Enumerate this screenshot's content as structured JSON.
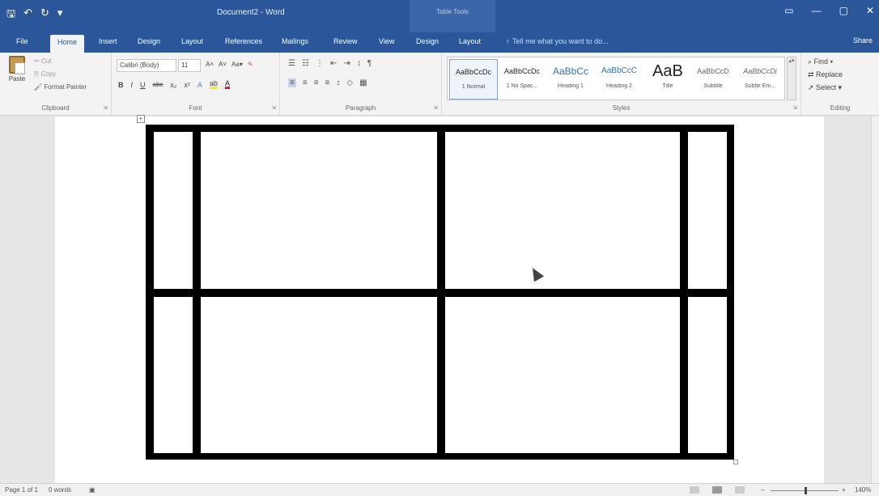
{
  "titlebar": {
    "qat": {
      "save": "🖫",
      "undo": "↶",
      "redo": "↻",
      "customize": "▾"
    },
    "document_title": "Document2 - Word",
    "context_group": "Table Tools",
    "window_buttons": {
      "ribbon_display": "▭",
      "minimize": "—",
      "maximize": "▢",
      "close": "✕"
    }
  },
  "tabs": {
    "file": "File",
    "home": "Home",
    "insert": "Insert",
    "design": "Design",
    "layout": "Layout",
    "references": "References",
    "mailings": "Mailings",
    "review": "Review",
    "view": "View",
    "table_design": "Design",
    "table_layout": "Layout",
    "tell_me": "♀ Tell me what you want to do...",
    "share": "Share"
  },
  "clipboard": {
    "paste": "Paste",
    "cut": "Cut",
    "copy": "Copy",
    "format_painter": "Format Painter",
    "label": "Clipboard"
  },
  "font": {
    "font_name": "Calibri (Body)",
    "font_size": "11",
    "grow": "A˄",
    "shrink": "A˅",
    "change_case": "Aa▾",
    "clear": "✎",
    "bold": "B",
    "italic": "I",
    "underline": "U",
    "strikethrough": "abc",
    "subscript": "x₂",
    "superscript": "x²",
    "text_effects": "A",
    "highlight": "ab",
    "font_color": "A",
    "label": "Font"
  },
  "paragraph": {
    "bullets": "☰",
    "numbering": "☷",
    "multilevel": "⋮",
    "decrease_indent": "⇤",
    "increase_indent": "⇥",
    "sort": "↕",
    "show_marks": "¶",
    "align_left": "≡",
    "center": "≡",
    "align_right": "≡",
    "justify": "≡",
    "line_spacing": "↕",
    "shading": "◇",
    "borders": "▦",
    "label": "Paragraph"
  },
  "styles": {
    "items": [
      {
        "sample": "AaBbCcDc",
        "name": "1 Normal"
      },
      {
        "sample": "AaBbCcDc",
        "name": "1 No Spac..."
      },
      {
        "sample": "AaBbCc",
        "name": "Heading 1"
      },
      {
        "sample": "AaBbCcC",
        "name": "Heading 2"
      },
      {
        "sample": "AaB",
        "name": "Title"
      },
      {
        "sample": "AaBbCcD",
        "name": "Subtitle"
      },
      {
        "sample": "AaBbCcDi",
        "name": "Subtle Em..."
      }
    ],
    "scroll": "▴▾",
    "label": "Styles"
  },
  "editing": {
    "find": "Find ▾",
    "replace": "Replace",
    "select": "Select ▾",
    "label": "Editing"
  },
  "document": {
    "move_handle": "+"
  },
  "statusbar": {
    "page": "Page 1 of 1",
    "words": "0 words",
    "proofing": "▣",
    "zoom_minus": "−",
    "zoom_plus": "+",
    "zoom": "140%"
  },
  "colors": {
    "brand": "#2b579a",
    "table_border": "#000000"
  }
}
